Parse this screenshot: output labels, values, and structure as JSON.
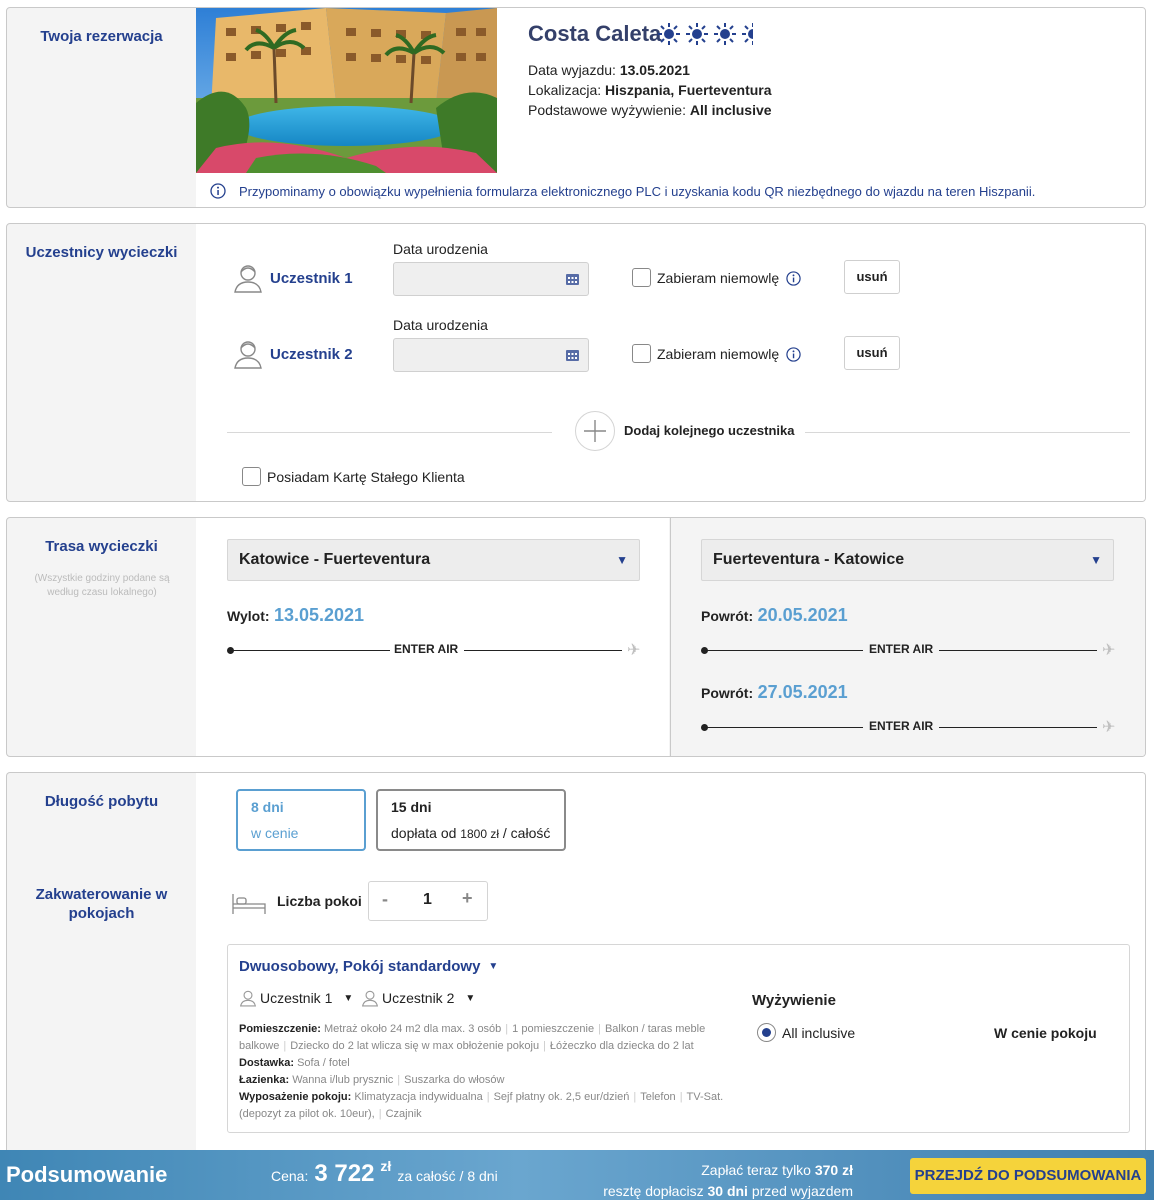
{
  "reservation": {
    "section_title": "Twoja rezerwacja",
    "hotel_name": "Costa Caleta",
    "stars": 3.5,
    "departure_label": "Data wyjazdu:",
    "departure_value": "13.05.2021",
    "location_label": "Lokalizacja:",
    "location_value": "Hiszpania, Fuerteventura",
    "board_label": "Podstawowe wyżywienie:",
    "board_value": "All inclusive",
    "notice": "Przypominamy o obowiązku wypełnienia formularza elektronicznego PLC i uzyskania kodu QR niezbędnego do wjazdu na teren Hiszpanii."
  },
  "participants": {
    "section_title": "Uczestnicy wycieczki",
    "list": [
      {
        "name": "Uczestnik 1",
        "dob_label": "Data urodzenia",
        "dob_value": "",
        "infant_label": "Zabieram niemowlę",
        "remove_label": "usuń"
      },
      {
        "name": "Uczestnik 2",
        "dob_label": "Data urodzenia",
        "dob_value": "",
        "infant_label": "Zabieram niemowlę",
        "remove_label": "usuń"
      }
    ],
    "add_label": "Dodaj kolejnego uczestnika",
    "loyalty_label": "Posiadam Kartę Stałego Klienta"
  },
  "route": {
    "section_title": "Trasa wycieczki",
    "note": "(Wszystkie godziny podane są według czasu lokalnego)",
    "outbound": {
      "select_value": "Katowice - Fuerteventura",
      "label": "Wylot:",
      "date": "13.05.2021",
      "airline": "ENTER AIR"
    },
    "return": {
      "select_value": "Fuerteventura - Katowice",
      "options": [
        {
          "label": "Powrót:",
          "date": "20.05.2021",
          "airline": "ENTER AIR"
        },
        {
          "label": "Powrót:",
          "date": "27.05.2021",
          "airline": "ENTER AIR"
        }
      ]
    }
  },
  "stay": {
    "section_title": "Długość pobytu",
    "options": [
      {
        "days": "8 dni",
        "note": "w cenie",
        "selected": true
      },
      {
        "days": "15 dni",
        "note_prefix": "dopłata od",
        "note_amount": "1800 zł",
        "note_suffix": "/ całość",
        "selected": false
      }
    ]
  },
  "accommodation": {
    "section_title": "Zakwaterowanie w pokojach",
    "rooms_label": "Liczba pokoi",
    "rooms_count": "1",
    "minus": "-",
    "plus": "+",
    "room_type": "Dwuosobowy, Pokój standardowy",
    "participants": [
      "Uczestnik 1",
      "Uczestnik 2"
    ],
    "board_title": "Wyżywienie",
    "board_option": "All inclusive",
    "board_price": "W cenie pokoju",
    "description": {
      "room_label": "Pomieszczenie:",
      "room_items": [
        "Metraż około 24 m2 dla max. 3 osób",
        "1 pomieszczenie",
        "Balkon / taras meble balkowe",
        "Dziecko do 2 lat wlicza się w max obłożenie pokoju",
        "Łóżeczko dla dziecka do 2 lat"
      ],
      "extra_label": "Dostawka:",
      "extra_items": [
        "Sofa / fotel"
      ],
      "bath_label": "Łazienka:",
      "bath_items": [
        "Wanna i/lub prysznic",
        "Suszarka do włosów"
      ],
      "equip_label": "Wyposażenie pokoju:",
      "equip_items": [
        "Klimatyzacja indywidualna",
        "Sejf płatny ok. 2,5 eur/dzień",
        "Telefon",
        "TV-Sat. (depozyt za pilot ok. 10eur),",
        "Czajnik"
      ]
    }
  },
  "summary": {
    "title": "Podsumowanie",
    "price_label": "Cena:",
    "price_value": "3 722",
    "currency": "zł",
    "price_note": "za całość / 8 dni",
    "pay_now_prefix": "Zapłać teraz tylko",
    "pay_now_amount": "370 zł",
    "rest_prefix": "resztę dopłacisz",
    "rest_days": "30 dni",
    "rest_suffix": "przed wyjazdem",
    "cta": "PRZEJDŹ DO PODSUMOWANIA"
  },
  "colors": {
    "brand_blue": "#24408e",
    "date_blue": "#5a9fd1",
    "cta_yellow": "#f5d33b",
    "footer_blue": "#4a8cbc"
  }
}
